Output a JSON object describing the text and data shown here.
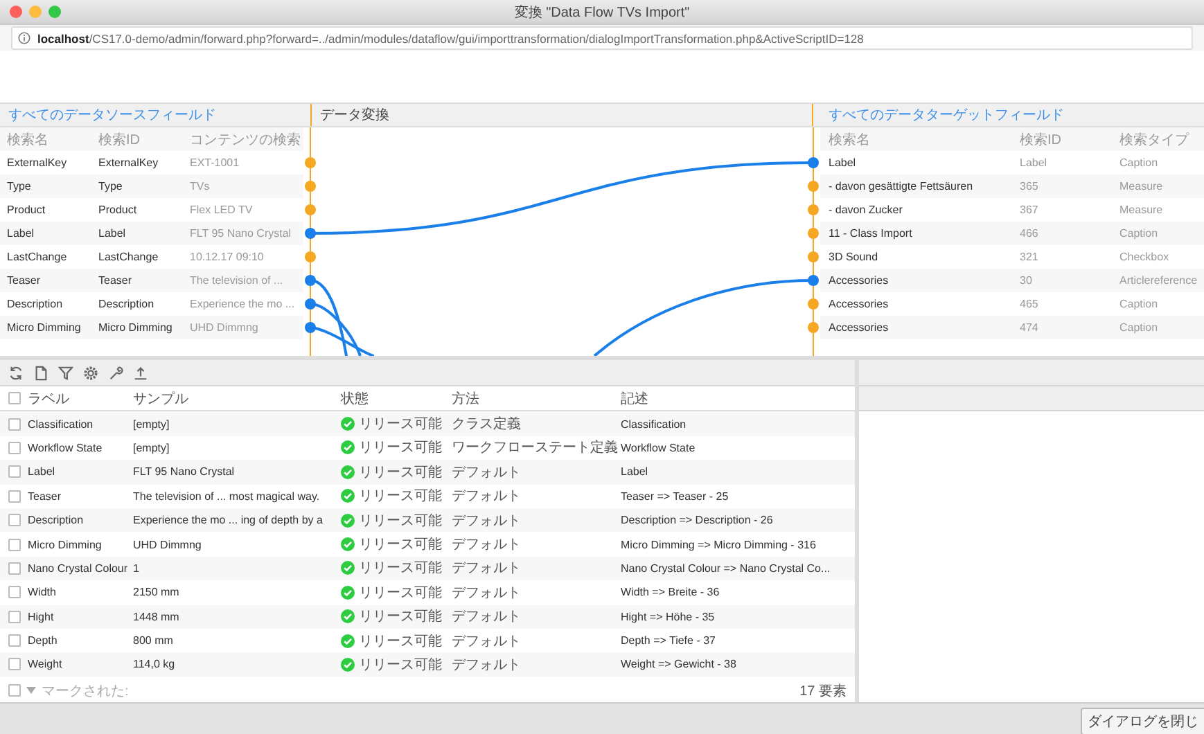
{
  "window": {
    "title": "変換 \"Data Flow TVs Import\""
  },
  "address_bar": {
    "host": "localhost",
    "path": "/CS17.0-demo/admin/forward.php?forward=../admin/modules/dataflow/gui/importtransformation/dialogImportTransformation.php&ActiveScriptID=128"
  },
  "source_panel": {
    "title": "すべてのデータソースフィールド",
    "columns": [
      "検索名",
      "検索ID",
      "コンテンツの検索"
    ],
    "rows": [
      {
        "name": "ExternalKey",
        "id": "ExternalKey",
        "content": "EXT-1001",
        "linked": false
      },
      {
        "name": "Type",
        "id": "Type",
        "content": "TVs",
        "linked": false
      },
      {
        "name": "Product",
        "id": "Product",
        "content": "Flex LED TV",
        "linked": false
      },
      {
        "name": "Label",
        "id": "Label",
        "content": "FLT 95 Nano Crystal",
        "linked": true
      },
      {
        "name": "LastChange",
        "id": "LastChange",
        "content": "10.12.17 09:10",
        "linked": false
      },
      {
        "name": "Teaser",
        "id": "Teaser",
        "content": "The television of ...",
        "linked": true
      },
      {
        "name": "Description",
        "id": "Description",
        "content": "Experience the mo ...",
        "linked": true
      },
      {
        "name": "Micro Dimming",
        "id": "Micro Dimming",
        "content": "UHD Dimmng",
        "linked": true
      }
    ]
  },
  "transform_panel": {
    "title": "データ変換"
  },
  "target_panel": {
    "title": "すべてのデータターゲットフィールド",
    "columns": [
      "検索名",
      "検索ID",
      "検索タイプ"
    ],
    "rows": [
      {
        "name": "Label",
        "id": "Label",
        "type": "Caption",
        "linked": true
      },
      {
        "name": "- davon gesättigte Fettsäuren",
        "id": "365",
        "type": "Measure",
        "linked": false
      },
      {
        "name": "- davon Zucker",
        "id": "367",
        "type": "Measure",
        "linked": false
      },
      {
        "name": "11 - Class Import",
        "id": "466",
        "type": "Caption",
        "linked": false
      },
      {
        "name": "3D Sound",
        "id": "321",
        "type": "Checkbox",
        "linked": false
      },
      {
        "name": "Accessories",
        "id": "30",
        "type": "Articlereference",
        "linked": true
      },
      {
        "name": "Accessories",
        "id": "465",
        "type": "Caption",
        "linked": false
      },
      {
        "name": "Accessories",
        "id": "474",
        "type": "Caption",
        "linked": false
      }
    ]
  },
  "table": {
    "select_all_checked": false,
    "columns": [
      "ラベル",
      "サンプル",
      "状態",
      "方法",
      "記述"
    ],
    "rows": [
      {
        "label": "Classification",
        "sample": "[empty]",
        "status": "リリース可能",
        "method": "クラス定義",
        "description": "Classification",
        "checked": false
      },
      {
        "label": "Workflow State",
        "sample": "[empty]",
        "status": "リリース可能",
        "method": "ワークフローステート定義",
        "description": "Workflow State",
        "checked": false
      },
      {
        "label": "Label",
        "sample": "FLT 95 Nano Crystal",
        "status": "リリース可能",
        "method": "デフォルト",
        "description": "Label",
        "checked": false
      },
      {
        "label": "Teaser",
        "sample": "The television of ... most magical way.",
        "status": "リリース可能",
        "method": "デフォルト",
        "description": "Teaser => Teaser - 25",
        "checked": false
      },
      {
        "label": "Description",
        "sample": "Experience the mo ... ing of depth by a",
        "status": "リリース可能",
        "method": "デフォルト",
        "description": "Description => Description - 26",
        "checked": false
      },
      {
        "label": "Micro Dimming",
        "sample": "UHD Dimmng",
        "status": "リリース可能",
        "method": "デフォルト",
        "description": "Micro Dimming => Micro Dimming - 316",
        "checked": false
      },
      {
        "label": "Nano Crystal Colour",
        "sample": "1",
        "status": "リリース可能",
        "method": "デフォルト",
        "description": "Nano Crystal Colour => Nano Crystal Co...",
        "checked": false
      },
      {
        "label": "Width",
        "sample": "2150 mm",
        "status": "リリース可能",
        "method": "デフォルト",
        "description": "Width => Breite - 36",
        "checked": false
      },
      {
        "label": "Hight",
        "sample": "1448 mm",
        "status": "リリース可能",
        "method": "デフォルト",
        "description": "Hight => Höhe - 35",
        "checked": false
      },
      {
        "label": "Depth",
        "sample": "800 mm",
        "status": "リリース可能",
        "method": "デフォルト",
        "description": "Depth => Tiefe - 37",
        "checked": false
      },
      {
        "label": "Weight",
        "sample": "114,0 kg",
        "status": "リリース可能",
        "method": "デフォルト",
        "description": "Weight => Gewicht - 38",
        "checked": false
      }
    ],
    "footer": {
      "checked": false,
      "marked": "マークされた:",
      "count": "17 要素"
    }
  },
  "close_button": "ダイアログを閉じ"
}
